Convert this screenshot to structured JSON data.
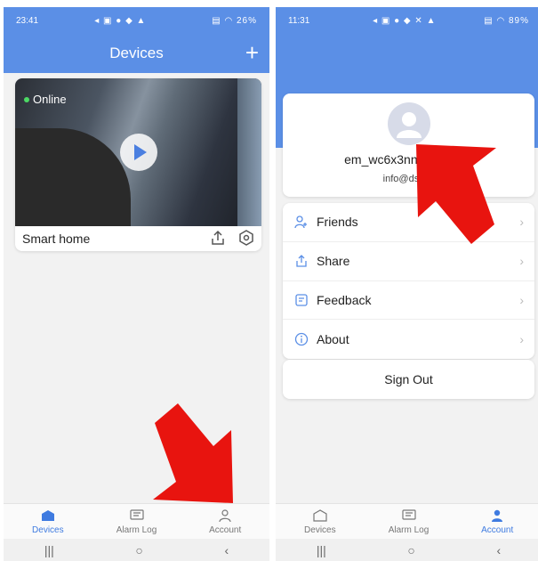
{
  "left": {
    "status": {
      "time": "23:41",
      "battery": "26%"
    },
    "header": {
      "title": "Devices",
      "add_label": "+"
    },
    "device": {
      "status": "Online",
      "name": "Smart home"
    },
    "tabs": [
      {
        "label": "Devices",
        "icon": "home-icon",
        "active": true
      },
      {
        "label": "Alarm Log",
        "icon": "alarm-log-icon",
        "active": false
      },
      {
        "label": "Account",
        "icon": "person-icon",
        "active": false
      }
    ]
  },
  "right": {
    "status": {
      "time": "11:31",
      "battery": "89%"
    },
    "profile": {
      "username": "em_wc6x3nn3…lkoz6p",
      "email": "info@dse…"
    },
    "menu": [
      {
        "label": "Friends",
        "icon": "friends-icon"
      },
      {
        "label": "Share",
        "icon": "share-icon"
      },
      {
        "label": "Feedback",
        "icon": "feedback-icon"
      },
      {
        "label": "About",
        "icon": "info-icon"
      }
    ],
    "signout_label": "Sign Out",
    "tabs": [
      {
        "label": "Devices",
        "icon": "home-icon",
        "active": false
      },
      {
        "label": "Alarm Log",
        "icon": "alarm-log-icon",
        "active": false
      },
      {
        "label": "Account",
        "icon": "person-icon",
        "active": true
      }
    ]
  },
  "colors": {
    "accent": "#5b8fe6",
    "active_tab": "#3f7be0",
    "arrow": "#e8140f",
    "online": "#4cd964"
  }
}
